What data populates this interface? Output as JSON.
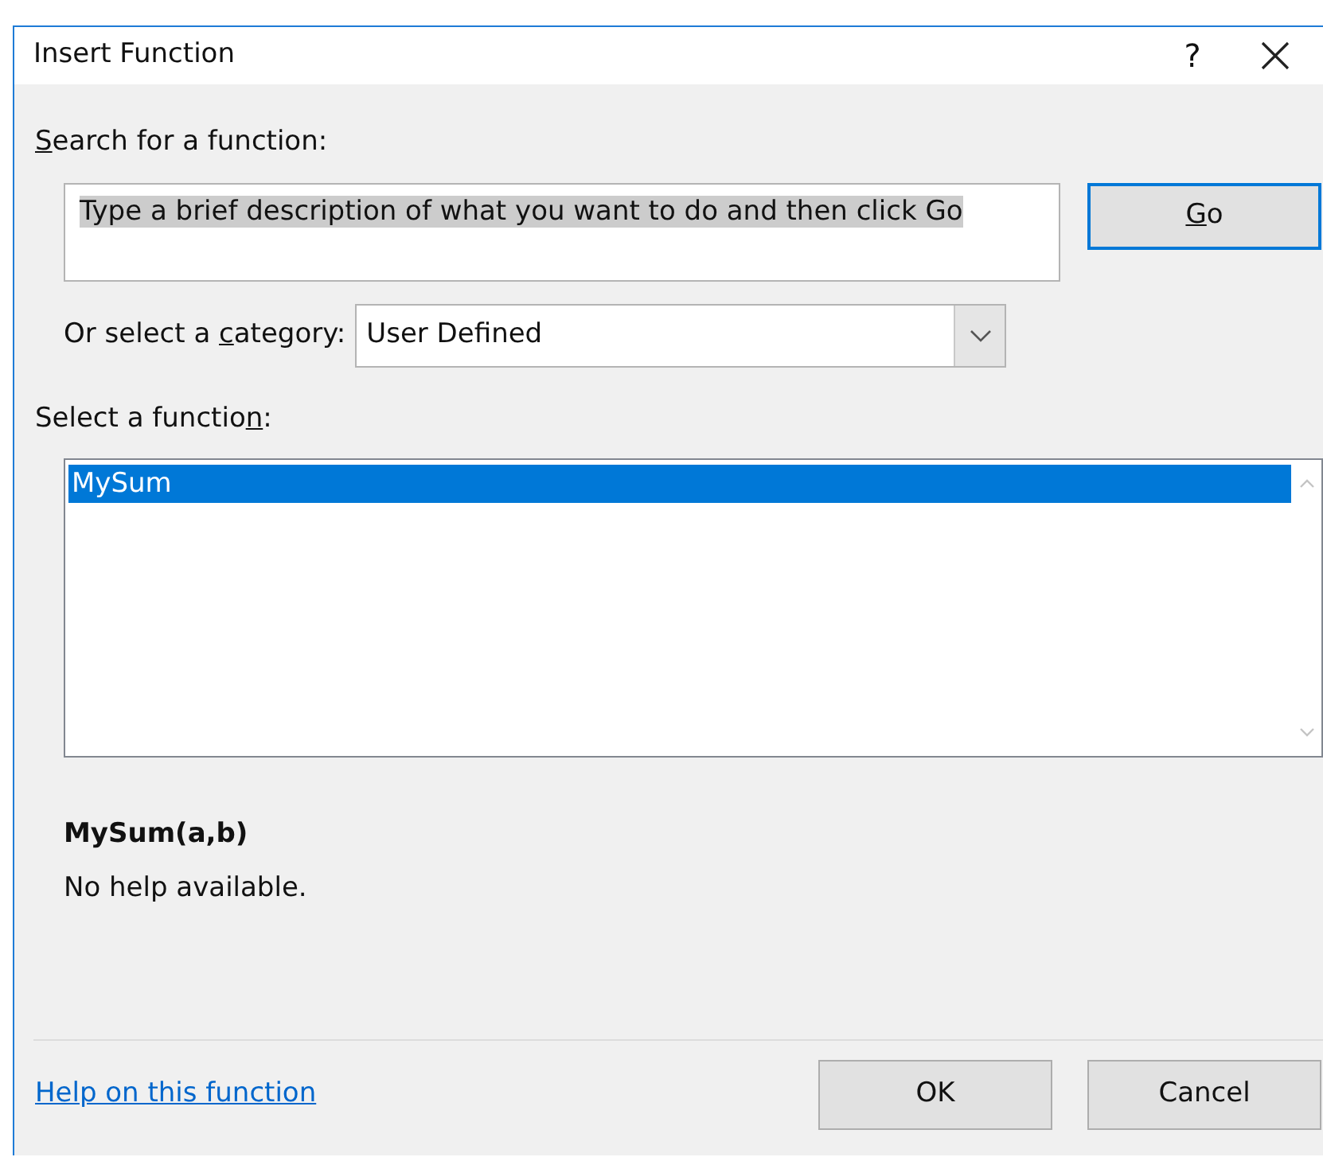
{
  "window": {
    "title": "Insert Function",
    "help_button": "?"
  },
  "search": {
    "label": {
      "key": "S",
      "post": "earch for a function:"
    },
    "value": "Type a brief description of what you want to do and then click Go",
    "text_selected": true
  },
  "go_button": {
    "label": {
      "key": "G",
      "post": "o"
    },
    "focused": true
  },
  "category": {
    "label": {
      "pre": "Or select a ",
      "key": "c",
      "post": "ategory:"
    },
    "value": "User Defined"
  },
  "function_list": {
    "label": {
      "pre": "Select a functio",
      "key": "n",
      "post": ":"
    },
    "items": [
      {
        "name": "MySum",
        "selected": true
      }
    ]
  },
  "signature": "MySum(a,b)",
  "description": "No help available.",
  "help_link": "Help on this function",
  "buttons": [
    {
      "label": "OK"
    },
    {
      "label": "Cancel"
    }
  ]
}
